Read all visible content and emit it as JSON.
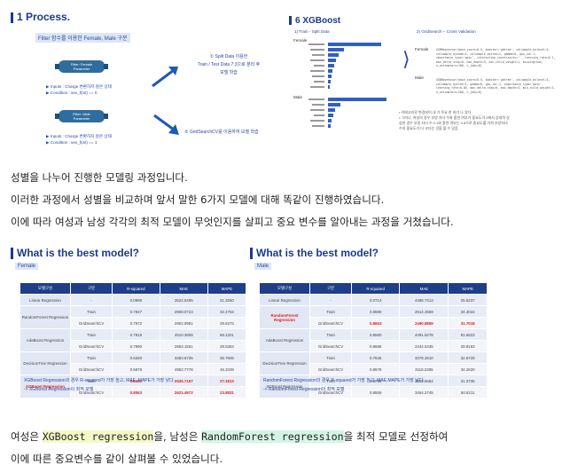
{
  "process": {
    "title": "1 Process.",
    "subtitle": "Filter 함수를 이용한 Female, Male 구분",
    "female_param_1": "Filter: Female",
    "female_param_2": "Parameter",
    "female_inputs": "▶ Inputs : Charge 변환하지 않은 상태",
    "female_condition": "▶ Condition : sex_f(int) == 0",
    "male_param_1": "Filter: Male",
    "male_param_2": "Parameter",
    "male_inputs": "▶ Inputs : Charge 변환하지 않은 상태",
    "male_condition": "▶ Condition : sex_f(int) == 1",
    "step1_line1": "① Split Data 이용한",
    "step1_line2": "Train / Test Data 7:3으로 분리 후",
    "step1_line3": "모델 학습",
    "step2": "② GridSearchCV를 이용하여 모델 학습"
  },
  "xgboost": {
    "title": "6 XGBoost",
    "train_split": "1) Train - Split Data",
    "gridsearch": "2) GridSearch – Cross Validation",
    "female_label": "Female",
    "male_label": "Male",
    "female_code": "XGBRegressor(base_score=0.5, booster='gbtree', colsample_bylevel=1, colsample_bynode=1, colsample_bytree=1, gamma=0, gpu_id=-1, importance_type='gain', interaction_constraints='', learning_rate=0.1, max_delta_step=0, max_depth=3, min_child_weight=1, missing=nan, n_estimators=100, n_jobs=8)",
    "male_code": "XGBRegressor(base_score=0.5, booster='gbtree', colsample_bylevel=1, colsample_bytree=1, gamma=0, gpu_id=-1, importance_type='gain', learning_rate=0.05, max_delta_step=0, max_depth=3, min_child_weight=1, n_estimators=200, n_jobs=8)",
    "note_1": "• 카테고리로 변경되어 내 가 주요 한 비가 나 었다.",
    "note_2": "• 그러나, 여성의 경우 부양 자녀 수와 흡연 여부가 중요도가 0에서 상대적 상",
    "note_3": "  승한 경우 부양 자녀 수 0.1와 흡연 여부는 0.6으로 중요도를 가져 부양자녀",
    "note_4": "  수의 중요도가 더 크다는 것을 볼 수 있음."
  },
  "paragraph1": [
    "성별을 나누어 진행한 모델링 과정입니다.",
    "이러한 과정에서 성별을 비교하며 앞서 말한 6가지 모델에 대해 똑같이 진행하였습니다.",
    "이에 따라 여성과 남성 각각의 최적 모델이 무엇인지를 살피고 중요 변수를 알아내는 과정을 거쳤습니다."
  ],
  "female_table": {
    "title": "What is the best model?",
    "tag": "Female",
    "headers": [
      "모델구성",
      "구분",
      "R-squared",
      "MAE",
      "MAPE"
    ],
    "rows": [
      {
        "model": "Linear Regression",
        "split": "-",
        "r2": "0.0999",
        "mae": "3522.5495",
        "mape": "21.3250"
      },
      {
        "model": "RandomForest Regression",
        "split": "Train",
        "r2": "0.7847",
        "mae": "2908.0723",
        "mape": "32.4753"
      },
      {
        "model": "",
        "split": "GridSearchCV",
        "r2": "0.7972",
        "mae": "2902.0951",
        "mape": "29.6373"
      },
      {
        "model": "AdaBoost Regression",
        "split": "Train",
        "r2": "0.7818",
        "mae": "4510.3908",
        "mape": "68.1321"
      },
      {
        "model": "",
        "split": "GridSearchCV",
        "r2": "0.7990",
        "mae": "2863.1551",
        "mape": "29.5353"
      },
      {
        "model": "DecisionTree Regression",
        "split": "Train",
        "r2": "0.6280",
        "mae": "3393.6735",
        "mape": "35.7606"
      },
      {
        "model": "",
        "split": "GridSearchCV",
        "r2": "0.5878",
        "mae": "4952.7778",
        "mape": "46.1039"
      },
      {
        "model": "XGBoost Regression",
        "split": "Train",
        "r2": "0.8402",
        "mae": "2535.7157",
        "mape": "27.1813"
      },
      {
        "model": "",
        "split": "GridSearchCV",
        "r2": "0.8063",
        "mae": "2621.4972",
        "mape": "23.8831"
      }
    ],
    "caption_1": "XGBoost Regression의 경우 R-squared가 가장 높고, MAE, MAPE가 가장 낮다.",
    "caption_2": "-> XGBoost Regression이 최적 모델"
  },
  "male_table": {
    "title": "What is the best model?",
    "tag": "Male",
    "headers": [
      "모델구성",
      "구분",
      "R-squared",
      "MAE",
      "MAPE"
    ],
    "rows": [
      {
        "model": "Linear Regression",
        "split": "-",
        "r2": "0.0714",
        "mae": "4486.7413",
        "mape": "25.6237"
      },
      {
        "model": "RandomForest Regression",
        "split": "Train",
        "r2": "0.8596",
        "mae": "2914.2559",
        "mape": "34.4022"
      },
      {
        "model": "",
        "split": "GridSearchCV",
        "r2": "0.8663",
        "mae": "2490.8895",
        "mape": "31.7018"
      },
      {
        "model": "AdaBoost Regression",
        "split": "Train",
        "r2": "0.8580",
        "mae": "4491.5278",
        "mape": "91.6623"
      },
      {
        "model": "",
        "split": "GridSearchCV",
        "r2": "0.8686",
        "mae": "2444.5435",
        "mape": "29.8163"
      },
      {
        "model": "DecisionTree Regression",
        "split": "Train",
        "r2": "0.7636",
        "mae": "3378.2610",
        "mape": "32.5729"
      },
      {
        "model": "",
        "split": "GridSearchCV",
        "r2": "0.8678",
        "mae": "3118.2285",
        "mape": "34.2620"
      },
      {
        "model": "XGBoost Regression",
        "split": "Train",
        "r2": "0.8796",
        "mae": "2562.6684",
        "mape": "31.3735"
      },
      {
        "model": "",
        "split": "GridSearchCV",
        "r2": "0.8559",
        "mae": "3464.2745",
        "mape": "50.8211"
      }
    ],
    "caption_1": "RandomForest Regression의 경우 R-squared가 가장 높고, MAE,MAPE가 가장 낮다.",
    "caption_2": "-> RandomForest Regression이 최적 모델"
  },
  "paragraph2": {
    "p1": "여성은 ",
    "p2": "XGBoost regression",
    "p3": "을, 남성은 ",
    "p4": "RandomForest regression",
    "p5": "을 최적 모델로 선정하여",
    "line2": "이에 따른 중요변수를 같이 살펴볼 수 있었습니다."
  }
}
